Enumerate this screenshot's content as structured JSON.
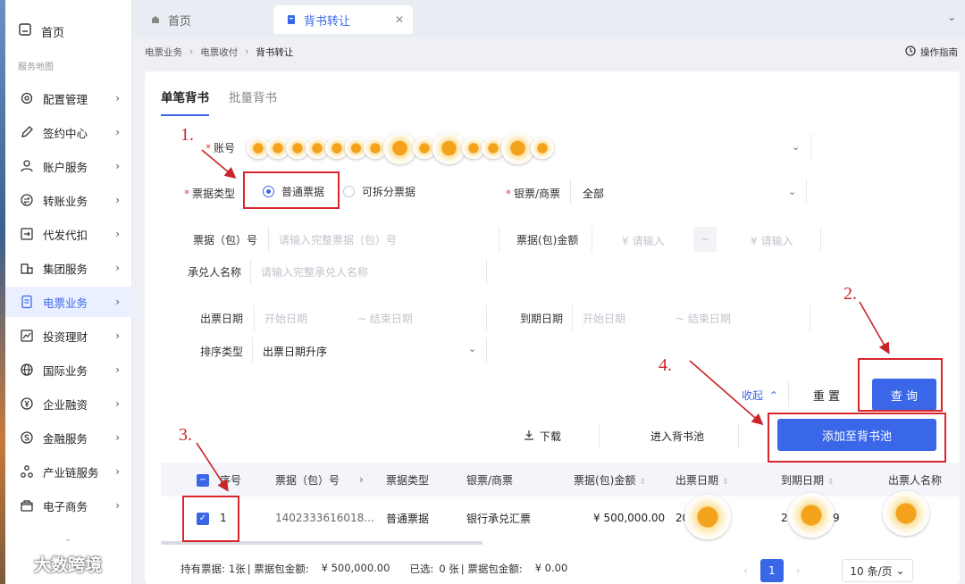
{
  "sidebar": {
    "home": "首页",
    "section": "服务地图",
    "items": [
      {
        "label": "配置管理",
        "icon": "settings-icon"
      },
      {
        "label": "签约中心",
        "icon": "pen-icon"
      },
      {
        "label": "账户服务",
        "icon": "user-icon"
      },
      {
        "label": "转账业务",
        "icon": "transfer-icon"
      },
      {
        "label": "代发代扣",
        "icon": "export-icon"
      },
      {
        "label": "集团服务",
        "icon": "building-icon"
      },
      {
        "label": "电票业务",
        "icon": "document-icon"
      },
      {
        "label": "投资理财",
        "icon": "chart-icon"
      },
      {
        "label": "国际业务",
        "icon": "globe-icon"
      },
      {
        "label": "企业融资",
        "icon": "coin-icon"
      },
      {
        "label": "金融服务",
        "icon": "money-icon"
      },
      {
        "label": "产业链服务",
        "icon": "network-icon"
      },
      {
        "label": "电子商务",
        "icon": "shop-icon"
      }
    ],
    "active_index": 6
  },
  "tabs": [
    {
      "label": "首页"
    },
    {
      "label": "背书转让"
    }
  ],
  "breadcrumb": [
    "电票业务",
    "电票收付",
    "背书转让"
  ],
  "guide_label": "操作指南",
  "subtabs": [
    "单笔背书",
    "批量背书"
  ],
  "form": {
    "account_label": "账号",
    "bill_type_label": "票据类型",
    "bill_type_options": [
      "普通票据",
      "可拆分票据"
    ],
    "bank_label": "银票/商票",
    "bank_value": "全部",
    "bill_no_label": "票据（包）号",
    "bill_no_placeholder": "请输入完整票据（包）号",
    "amount_label": "票据(包)金额",
    "amount_min_placeholder": "¥ 请输入",
    "amount_sep": "~",
    "amount_max_placeholder": "¥ 请输入",
    "acceptor_label": "承兑人名称",
    "acceptor_placeholder": "请输入完整承兑人名称",
    "issue_date_label": "出票日期",
    "issue_start_placeholder": "开始日期",
    "issue_end_placeholder": "~ 结束日期",
    "due_date_label": "到期日期",
    "due_start_placeholder": "开始日期",
    "due_end_placeholder": "~ 结束日期",
    "sort_label": "排序类型",
    "sort_value": "出票日期升序"
  },
  "actions": {
    "collapse": "收起",
    "reset": "重 置",
    "query": "查 询",
    "download": "下载",
    "enter_pool": "进入背书池",
    "add_pool": "添加至背书池"
  },
  "table": {
    "headers": [
      "序号",
      "票据（包）号",
      "票据类型",
      "银票/商票",
      "票据(包)金额",
      "出票日期",
      "到期日期",
      "出票人名称"
    ],
    "rows": [
      {
        "index": "1",
        "bill_no": "1402333616018...",
        "type": "普通票据",
        "bank": "银行承兑汇票",
        "amount": "¥ 500,000.00",
        "issue_date": "20",
        "due_date": "2",
        "due_suffix": "9"
      }
    ]
  },
  "footer": {
    "held_label": "持有票据:",
    "held_count": "1张",
    "held_amount_label": "| 票据包金额:",
    "held_amount": "¥ 500,000.00",
    "selected_label": "已选:",
    "selected_count": "0 张",
    "selected_amount_label": "| 票据包金额:",
    "selected_amount": "¥ 0.00",
    "page": "1",
    "page_size": "10 条/页"
  },
  "annotations": [
    "1.",
    "2.",
    "3.",
    "4."
  ],
  "watermark": "大数跨境",
  "colors": {
    "primary": "#3a67e8",
    "annotation": "#c8242a"
  }
}
